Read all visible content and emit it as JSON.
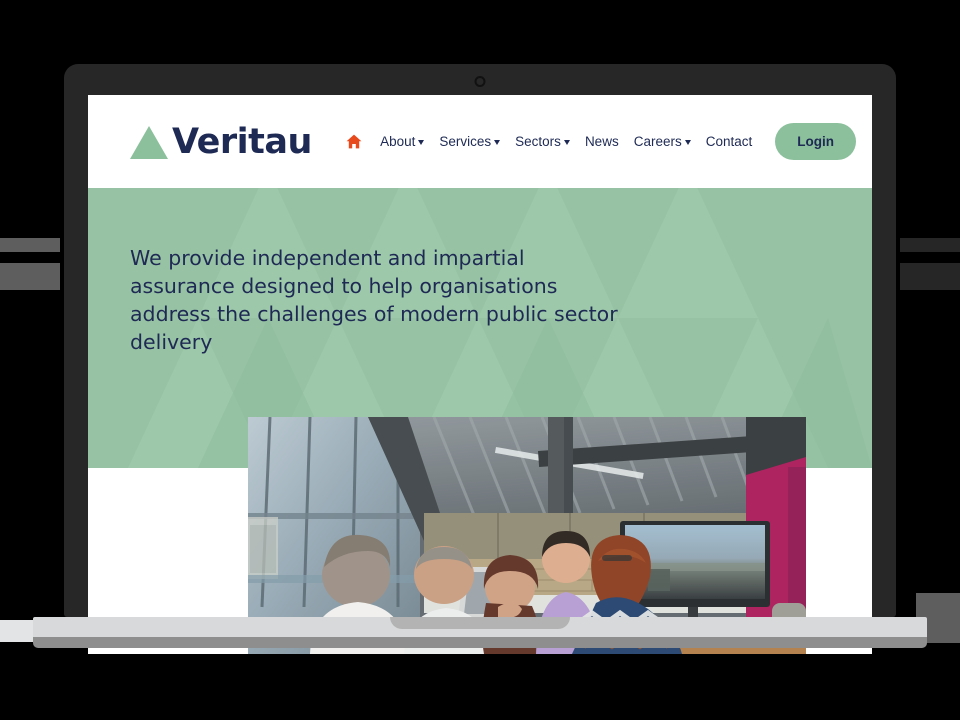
{
  "device": {
    "type": "laptop-mockup",
    "webcam": "webcam-dot"
  },
  "site": {
    "logo": {
      "text": "Veritau",
      "mark": "triangle-icon",
      "mark_color": "#8cc09c",
      "text_color": "#1e2a54"
    },
    "nav": {
      "home_icon": "home-icon",
      "home_icon_color": "#e8491d",
      "items": [
        {
          "label": "About",
          "has_dropdown": true
        },
        {
          "label": "Services",
          "has_dropdown": true
        },
        {
          "label": "Sectors",
          "has_dropdown": true
        },
        {
          "label": "News",
          "has_dropdown": false
        },
        {
          "label": "Careers",
          "has_dropdown": true
        },
        {
          "label": "Contact",
          "has_dropdown": false
        }
      ],
      "login_label": "Login"
    },
    "hero": {
      "headline": "We provide independent and impartial assurance designed to help organisations address the challenges of modern public sector delivery",
      "background_color": "#97c2a4",
      "text_color": "#1e2a54",
      "pattern": "triangles"
    },
    "photo": {
      "alt": "Office meeting — colleagues gathered around a table in a modern open-plan office with a large wall display",
      "colors": {
        "ceiling": "#6c737a",
        "window": "#9fb2bd",
        "brick": "#b8a98c",
        "accent_wall": "#a8165a",
        "screen": "#8fa7bb"
      }
    }
  },
  "colors": {
    "brand_green": "#8cc09c",
    "hero_green": "#97c2a4",
    "navy": "#1e2a54",
    "orange": "#e8491d",
    "bezel": "#272727",
    "base": "#d7d9da",
    "base_lip": "#8e8e8e",
    "backdrop": "#000000"
  }
}
